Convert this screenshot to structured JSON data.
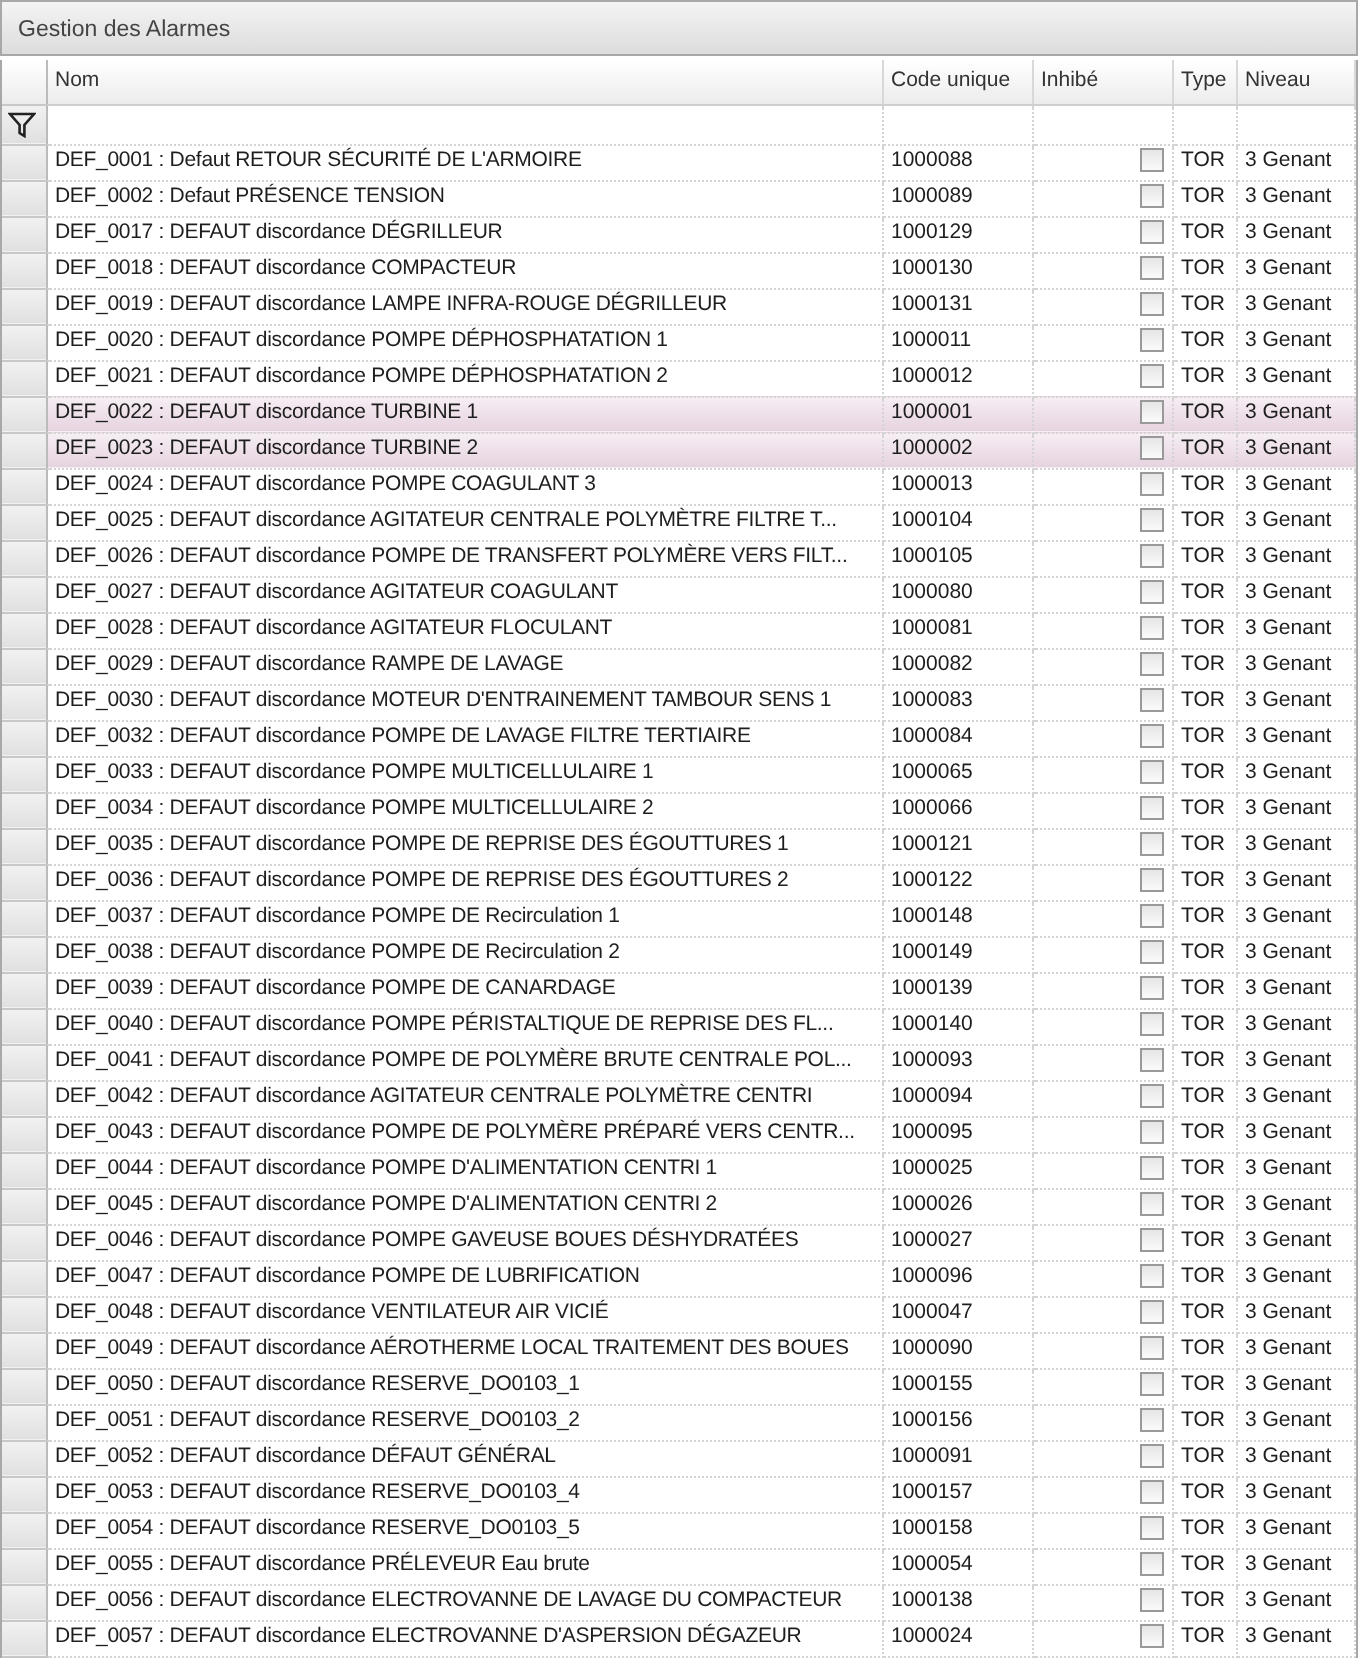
{
  "window": {
    "title": "Gestion des Alarmes"
  },
  "table": {
    "columns": [
      "Nom",
      "Code unique",
      "Inhibé",
      "Type",
      "Niveau"
    ],
    "rows": [
      {
        "name": "DEF_0001 : Defaut RETOUR SÉCURITÉ DE L'ARMOIRE",
        "code": "1000088",
        "inhibited": false,
        "type": "TOR",
        "level_text": "3 Genant",
        "selected": false
      },
      {
        "name": "DEF_0002 : Defaut PRÉSENCE TENSION",
        "code": "1000089",
        "inhibited": false,
        "type": "TOR",
        "level_text": "3 Genant",
        "selected": false
      },
      {
        "name": "DEF_0017 : DEFAUT discordance DÉGRILLEUR",
        "code": "1000129",
        "inhibited": false,
        "type": "TOR",
        "level_text": "3 Genant",
        "selected": false
      },
      {
        "name": "DEF_0018 : DEFAUT discordance COMPACTEUR",
        "code": "1000130",
        "inhibited": false,
        "type": "TOR",
        "level_text": "3 Genant",
        "selected": false
      },
      {
        "name": "DEF_0019 : DEFAUT discordance LAMPE INFRA-ROUGE DÉGRILLEUR",
        "code": "1000131",
        "inhibited": false,
        "type": "TOR",
        "level_text": "3 Genant",
        "selected": false
      },
      {
        "name": "DEF_0020 : DEFAUT discordance POMPE DÉPHOSPHATATION 1",
        "code": "1000011",
        "inhibited": false,
        "type": "TOR",
        "level_text": "3 Genant",
        "selected": false
      },
      {
        "name": "DEF_0021 : DEFAUT discordance POMPE DÉPHOSPHATATION 2",
        "code": "1000012",
        "inhibited": false,
        "type": "TOR",
        "level_text": "3 Genant",
        "selected": false
      },
      {
        "name": "DEF_0022 : DEFAUT discordance TURBINE 1",
        "code": "1000001",
        "inhibited": false,
        "type": "TOR",
        "level_text": "3 Genant",
        "selected": true
      },
      {
        "name": "DEF_0023 : DEFAUT discordance TURBINE 2",
        "code": "1000002",
        "inhibited": false,
        "type": "TOR",
        "level_text": "3 Genant",
        "selected": true
      },
      {
        "name": "DEF_0024 : DEFAUT discordance POMPE COAGULANT 3",
        "code": "1000013",
        "inhibited": false,
        "type": "TOR",
        "level_text": "3 Genant",
        "selected": false
      },
      {
        "name": "DEF_0025 : DEFAUT discordance AGITATEUR CENTRALE POLYMÈTRE FILTRE T...",
        "code": "1000104",
        "inhibited": false,
        "type": "TOR",
        "level_text": "3 Genant",
        "selected": false
      },
      {
        "name": "DEF_0026 : DEFAUT discordance POMPE DE TRANSFERT POLYMÈRE VERS FILT...",
        "code": "1000105",
        "inhibited": false,
        "type": "TOR",
        "level_text": "3 Genant",
        "selected": false
      },
      {
        "name": "DEF_0027 : DEFAUT discordance AGITATEUR COAGULANT",
        "code": "1000080",
        "inhibited": false,
        "type": "TOR",
        "level_text": "3 Genant",
        "selected": false
      },
      {
        "name": "DEF_0028 : DEFAUT discordance AGITATEUR FLOCULANT",
        "code": "1000081",
        "inhibited": false,
        "type": "TOR",
        "level_text": "3 Genant",
        "selected": false
      },
      {
        "name": "DEF_0029 : DEFAUT discordance RAMPE DE LAVAGE",
        "code": "1000082",
        "inhibited": false,
        "type": "TOR",
        "level_text": "3 Genant",
        "selected": false
      },
      {
        "name": "DEF_0030 : DEFAUT discordance MOTEUR D'ENTRAINEMENT TAMBOUR SENS 1",
        "code": "1000083",
        "inhibited": false,
        "type": "TOR",
        "level_text": "3 Genant",
        "selected": false
      },
      {
        "name": "DEF_0032 : DEFAUT discordance POMPE DE LAVAGE FILTRE TERTIAIRE",
        "code": "1000084",
        "inhibited": false,
        "type": "TOR",
        "level_text": "3 Genant",
        "selected": false
      },
      {
        "name": "DEF_0033 : DEFAUT discordance POMPE MULTICELLULAIRE 1",
        "code": "1000065",
        "inhibited": false,
        "type": "TOR",
        "level_text": "3 Genant",
        "selected": false
      },
      {
        "name": "DEF_0034 : DEFAUT discordance POMPE MULTICELLULAIRE 2",
        "code": "1000066",
        "inhibited": false,
        "type": "TOR",
        "level_text": "3 Genant",
        "selected": false
      },
      {
        "name": "DEF_0035 : DEFAUT discordance POMPE DE REPRISE DES ÉGOUTTURES 1",
        "code": "1000121",
        "inhibited": false,
        "type": "TOR",
        "level_text": "3 Genant",
        "selected": false
      },
      {
        "name": "DEF_0036 : DEFAUT discordance POMPE DE REPRISE DES ÉGOUTTURES 2",
        "code": "1000122",
        "inhibited": false,
        "type": "TOR",
        "level_text": "3 Genant",
        "selected": false
      },
      {
        "name": "DEF_0037 : DEFAUT discordance POMPE DE Recirculation 1",
        "code": "1000148",
        "inhibited": false,
        "type": "TOR",
        "level_text": "3 Genant",
        "selected": false
      },
      {
        "name": "DEF_0038 : DEFAUT discordance POMPE DE Recirculation 2",
        "code": "1000149",
        "inhibited": false,
        "type": "TOR",
        "level_text": "3 Genant",
        "selected": false
      },
      {
        "name": "DEF_0039 : DEFAUT discordance POMPE DE CANARDAGE",
        "code": "1000139",
        "inhibited": false,
        "type": "TOR",
        "level_text": "3 Genant",
        "selected": false
      },
      {
        "name": "DEF_0040 : DEFAUT discordance POMPE PÉRISTALTIQUE DE REPRISE DES FL...",
        "code": "1000140",
        "inhibited": false,
        "type": "TOR",
        "level_text": "3 Genant",
        "selected": false
      },
      {
        "name": "DEF_0041 : DEFAUT discordance POMPE DE POLYMÈRE BRUTE CENTRALE POL...",
        "code": "1000093",
        "inhibited": false,
        "type": "TOR",
        "level_text": "3 Genant",
        "selected": false
      },
      {
        "name": "DEF_0042 : DEFAUT discordance AGITATEUR CENTRALE POLYMÈTRE CENTRI",
        "code": "1000094",
        "inhibited": false,
        "type": "TOR",
        "level_text": "3 Genant",
        "selected": false
      },
      {
        "name": "DEF_0043 : DEFAUT discordance POMPE DE POLYMÈRE PRÉPARÉ VERS CENTR...",
        "code": "1000095",
        "inhibited": false,
        "type": "TOR",
        "level_text": "3 Genant",
        "selected": false
      },
      {
        "name": "DEF_0044 : DEFAUT discordance POMPE D'ALIMENTATION CENTRI 1",
        "code": "1000025",
        "inhibited": false,
        "type": "TOR",
        "level_text": "3 Genant",
        "selected": false
      },
      {
        "name": "DEF_0045 : DEFAUT discordance POMPE D'ALIMENTATION CENTRI 2",
        "code": "1000026",
        "inhibited": false,
        "type": "TOR",
        "level_text": "3 Genant",
        "selected": false
      },
      {
        "name": "DEF_0046 : DEFAUT discordance POMPE GAVEUSE BOUES DÉSHYDRATÉES",
        "code": "1000027",
        "inhibited": false,
        "type": "TOR",
        "level_text": "3 Genant",
        "selected": false
      },
      {
        "name": "DEF_0047 : DEFAUT discordance POMPE DE LUBRIFICATION",
        "code": "1000096",
        "inhibited": false,
        "type": "TOR",
        "level_text": "3 Genant",
        "selected": false
      },
      {
        "name": "DEF_0048 : DEFAUT discordance VENTILATEUR AIR VICIÉ",
        "code": "1000047",
        "inhibited": false,
        "type": "TOR",
        "level_text": "3 Genant",
        "selected": false
      },
      {
        "name": "DEF_0049 : DEFAUT discordance AÉROTHERME LOCAL TRAITEMENT DES BOUES",
        "code": "1000090",
        "inhibited": false,
        "type": "TOR",
        "level_text": "3 Genant",
        "selected": false
      },
      {
        "name": "DEF_0050 : DEFAUT discordance RESERVE_DO0103_1",
        "code": "1000155",
        "inhibited": false,
        "type": "TOR",
        "level_text": "3 Genant",
        "selected": false
      },
      {
        "name": "DEF_0051 : DEFAUT discordance RESERVE_DO0103_2",
        "code": "1000156",
        "inhibited": false,
        "type": "TOR",
        "level_text": "3 Genant",
        "selected": false
      },
      {
        "name": "DEF_0052 : DEFAUT discordance DÉFAUT GÉNÉRAL",
        "code": "1000091",
        "inhibited": false,
        "type": "TOR",
        "level_text": "3 Genant",
        "selected": false
      },
      {
        "name": "DEF_0053 : DEFAUT discordance RESERVE_DO0103_4",
        "code": "1000157",
        "inhibited": false,
        "type": "TOR",
        "level_text": "3 Genant",
        "selected": false
      },
      {
        "name": "DEF_0054 : DEFAUT discordance RESERVE_DO0103_5",
        "code": "1000158",
        "inhibited": false,
        "type": "TOR",
        "level_text": "3 Genant",
        "selected": false
      },
      {
        "name": "DEF_0055 : DEFAUT discordance PRÉLEVEUR Eau brute",
        "code": "1000054",
        "inhibited": false,
        "type": "TOR",
        "level_text": "3 Genant",
        "selected": false
      },
      {
        "name": "DEF_0056 : DEFAUT discordance ELECTROVANNE DE LAVAGE DU COMPACTEUR",
        "code": "1000138",
        "inhibited": false,
        "type": "TOR",
        "level_text": "3 Genant",
        "selected": false
      },
      {
        "name": "DEF_0057 : DEFAUT discordance ELECTROVANNE D'ASPERSION DÉGAZEUR",
        "code": "1000024",
        "inhibited": false,
        "type": "TOR",
        "level_text": "3 Genant",
        "selected": false
      }
    ]
  }
}
